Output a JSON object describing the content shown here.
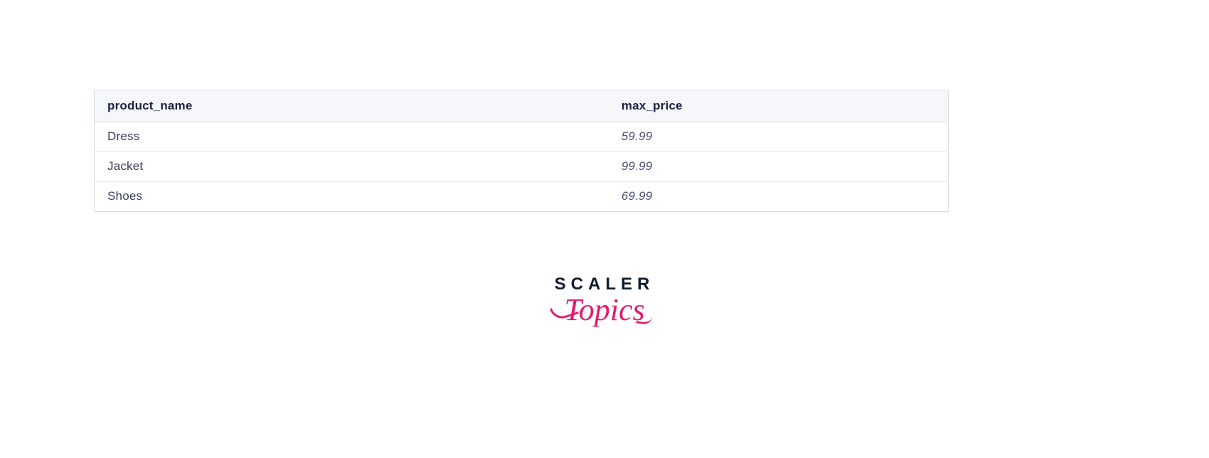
{
  "table": {
    "headers": {
      "product_name": "product_name",
      "max_price": "max_price"
    },
    "rows": [
      {
        "product_name": "Dress",
        "max_price": "59.99"
      },
      {
        "product_name": "Jacket",
        "max_price": "99.99"
      },
      {
        "product_name": "Shoes",
        "max_price": "69.99"
      }
    ]
  },
  "logo": {
    "line1": "SCALER",
    "line2": "Topics"
  }
}
